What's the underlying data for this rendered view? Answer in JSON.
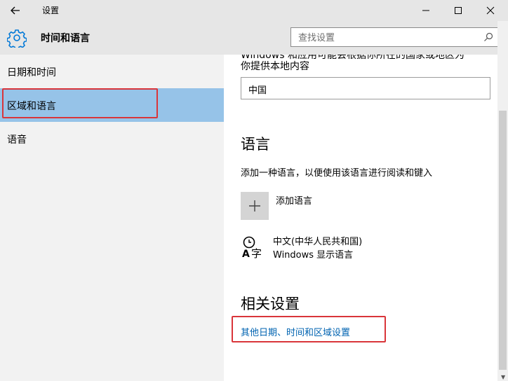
{
  "window": {
    "title": "设置"
  },
  "header": {
    "title": "时间和语言",
    "search_placeholder": "查找设置"
  },
  "sidebar": {
    "items": [
      {
        "label": "日期和时间"
      },
      {
        "label": "区域和语言",
        "selected": true
      },
      {
        "label": "语音"
      }
    ]
  },
  "main": {
    "region_desc_partial": "Windows 和应用可能会根据你所在的国家或地区为",
    "region_desc_line2": "你提供本地内容",
    "region_value": "中国",
    "language_heading": "语言",
    "language_desc": "添加一种语言，以便使用该语言进行阅读和键入",
    "add_language_label": "添加语言",
    "language_entry": {
      "name": "中文(中华人民共和国)",
      "sub": "Windows 显示语言"
    },
    "related_heading": "相关设置",
    "related_link": "其他日期、时间和区域设置"
  },
  "colors": {
    "selected_bg": "#96c3e8",
    "highlight_frame": "#d9353a",
    "link": "#0063b1",
    "accent": "#0078d7"
  }
}
